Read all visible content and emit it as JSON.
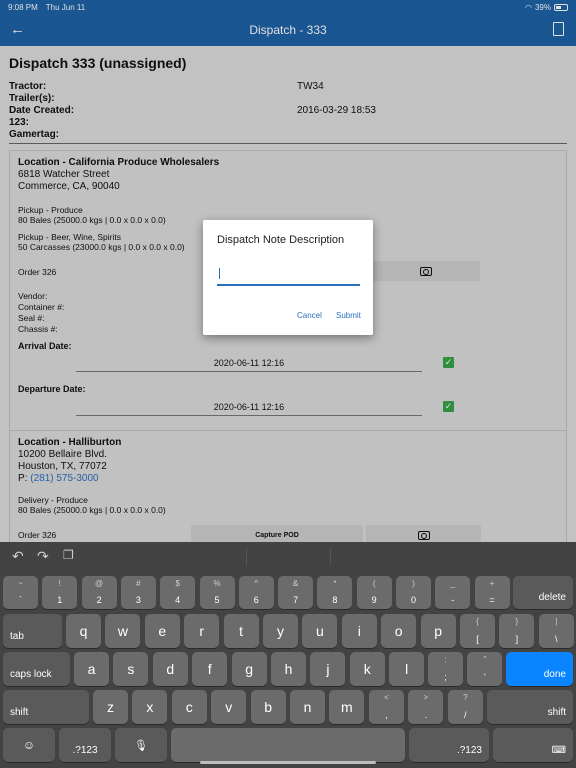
{
  "status": {
    "time": "9:08 PM",
    "date": "Thu Jun 11",
    "battery": "39%"
  },
  "appbar": {
    "title": "Dispatch - 333",
    "back_icon": "arrow-left-icon",
    "action_icon": "document-icon"
  },
  "page": {
    "title": "Dispatch 333 (unassigned)",
    "info": [
      {
        "label": "Tractor:",
        "value": "TW34"
      },
      {
        "label": "Trailer(s):",
        "value": ""
      },
      {
        "label": "Date Created:",
        "value": "2016-03-29 18:53"
      },
      {
        "label": "123:",
        "value": ""
      },
      {
        "label": "Gamertag:",
        "value": ""
      }
    ]
  },
  "card1": {
    "location": "Location - California Produce Wholesalers",
    "address1": "6818 Watcher Street",
    "address2": "Commerce, CA, 90040",
    "pickup1_title": "Pickup - Produce",
    "pickup1_detail": "80 Bales (25000.0 kgs | 0.0 x 0.0 x 0.0)",
    "pickup2_title": "Pickup - Beer, Wine, Spirits",
    "pickup2_detail": "50 Carcasses (23000.0 kgs | 0.0 x 0.0 x 0.0)",
    "order": "Order 326",
    "vendor": "Vendor:",
    "container": "Container #:",
    "seal": "Seal #:",
    "chassis": "Chassis #:",
    "arrival_label": "Arrival Date:",
    "arrival_value": "2020-06-11 12:16",
    "departure_label": "Departure Date:",
    "departure_value": "2020-06-11 12:16"
  },
  "card2": {
    "location": "Location - Halliburton",
    "address1": "10200 Bellaire Blvd.",
    "address2": "Houston, TX, 77072",
    "phone_prefix": "P:",
    "phone": "(281) 575-3000",
    "delivery_title": "Delivery - Produce",
    "delivery_detail": "80 Bales (25000.0 kgs | 0.0 x 0.0 x 0.0)",
    "order": "Order 326",
    "capture_pod": "Capture POD"
  },
  "dialog": {
    "title": "Dispatch Note Description",
    "input_value": "",
    "input_placeholder": "",
    "cancel": "Cancel",
    "submit": "Submit"
  },
  "keyboard": {
    "row1": [
      {
        "top": "~",
        "bottom": "`"
      },
      {
        "top": "!",
        "bottom": "1"
      },
      {
        "top": "@",
        "bottom": "2"
      },
      {
        "top": "#",
        "bottom": "3"
      },
      {
        "top": "$",
        "bottom": "4"
      },
      {
        "top": "%",
        "bottom": "5"
      },
      {
        "top": "^",
        "bottom": "6"
      },
      {
        "top": "&",
        "bottom": "7"
      },
      {
        "top": "*",
        "bottom": "8"
      },
      {
        "top": "(",
        "bottom": "9"
      },
      {
        "top": ")",
        "bottom": "0"
      },
      {
        "top": "_",
        "bottom": "-"
      },
      {
        "top": "+",
        "bottom": "="
      }
    ],
    "delete": "delete",
    "tab": "tab",
    "row2": [
      "q",
      "w",
      "e",
      "r",
      "t",
      "y",
      "u",
      "i",
      "o",
      "p"
    ],
    "row2_sym": [
      {
        "top": "{",
        "bottom": "["
      },
      {
        "top": "}",
        "bottom": "]"
      },
      {
        "top": "|",
        "bottom": "\\"
      }
    ],
    "caps": "caps lock",
    "row3": [
      "a",
      "s",
      "d",
      "f",
      "g",
      "h",
      "j",
      "k",
      "l"
    ],
    "row3_sym": [
      {
        "top": ":",
        "bottom": ";"
      },
      {
        "top": "\"",
        "bottom": "'"
      }
    ],
    "done": "done",
    "shift": "shift",
    "row4": [
      "z",
      "x",
      "c",
      "v",
      "b",
      "n",
      "m"
    ],
    "row4_sym": [
      {
        "top": "<",
        "bottom": ","
      },
      {
        "top": ">",
        "bottom": "."
      },
      {
        "top": "?",
        "bottom": "/"
      }
    ],
    "numbers": ".?123",
    "emoji_icon": "emoji-icon",
    "mic_icon": "microphone-icon",
    "hide_icon": "keyboard-hide-icon",
    "undo_icon": "undo-icon",
    "redo_icon": "redo-icon",
    "paste_icon": "clipboard-icon"
  }
}
